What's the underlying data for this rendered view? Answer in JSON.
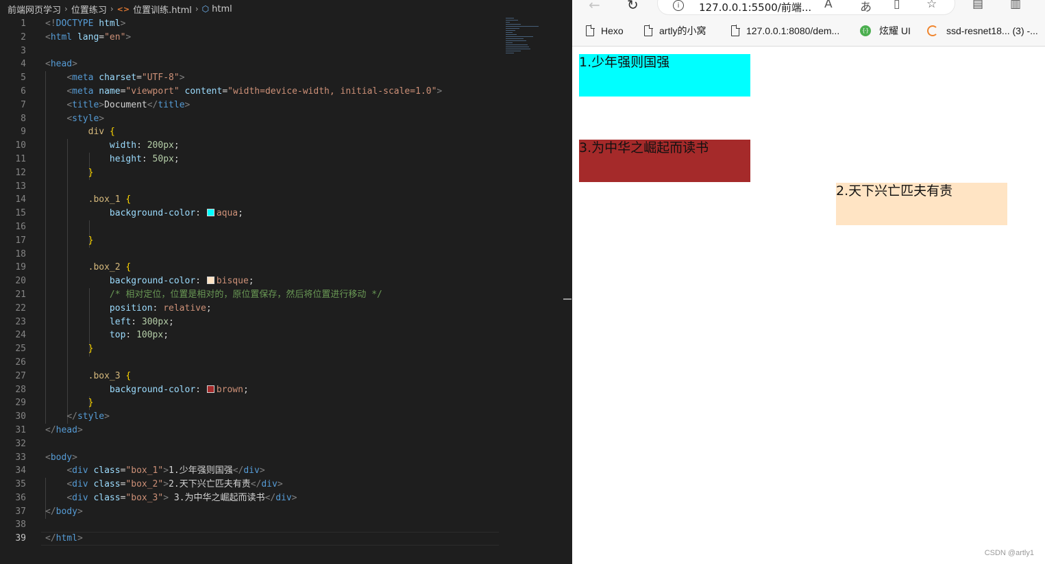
{
  "editor": {
    "breadcrumb": [
      "前端网页学习",
      "位置练习",
      "位置训练.html",
      "html"
    ],
    "current_line": 39
  },
  "browser": {
    "url": "127.0.0.1:5500/前端...",
    "favorites": [
      "Hexo",
      "artly的小窝",
      "127.0.0.1:8080/dem...",
      "炫耀 UI",
      "ssd-resnet18... (3) -..."
    ],
    "boxes": {
      "box_1": "1.少年强则国强",
      "box_2": "2.天下兴亡匹夫有责",
      "box_3": "3.为中华之崛起而读书"
    },
    "watermark": "CSDN @artly1"
  },
  "colors": {
    "aqua": "#00ffff",
    "bisque": "#ffe4c4",
    "brown": "#a52a2a"
  },
  "code_lines": [
    [
      [
        "t-bk",
        "<!"
      ],
      [
        "t-tag",
        "DOCTYPE"
      ],
      [
        "t-text",
        " "
      ],
      [
        "t-attr",
        "html"
      ],
      [
        "t-bk",
        ">"
      ]
    ],
    [
      [
        "t-bk",
        "<"
      ],
      [
        "t-tag",
        "html"
      ],
      [
        "t-text",
        " "
      ],
      [
        "t-attr",
        "lang"
      ],
      [
        "t-text",
        "="
      ],
      [
        "t-str",
        "\"en\""
      ],
      [
        "t-bk",
        ">"
      ]
    ],
    [],
    [
      [
        "t-bk",
        "<"
      ],
      [
        "t-tag",
        "head"
      ],
      [
        "t-bk",
        ">"
      ]
    ],
    [
      [
        "t-text",
        "    "
      ],
      [
        "t-bk",
        "<"
      ],
      [
        "t-tag",
        "meta"
      ],
      [
        "t-text",
        " "
      ],
      [
        "t-attr",
        "charset"
      ],
      [
        "t-text",
        "="
      ],
      [
        "t-str",
        "\"UTF-8\""
      ],
      [
        "t-bk",
        ">"
      ]
    ],
    [
      [
        "t-text",
        "    "
      ],
      [
        "t-bk",
        "<"
      ],
      [
        "t-tag",
        "meta"
      ],
      [
        "t-text",
        " "
      ],
      [
        "t-attr",
        "name"
      ],
      [
        "t-text",
        "="
      ],
      [
        "t-str",
        "\"viewport\""
      ],
      [
        "t-text",
        " "
      ],
      [
        "t-attr",
        "content"
      ],
      [
        "t-text",
        "="
      ],
      [
        "t-str",
        "\"width=device-width, initial-scale=1.0\""
      ],
      [
        "t-bk",
        ">"
      ]
    ],
    [
      [
        "t-text",
        "    "
      ],
      [
        "t-bk",
        "<"
      ],
      [
        "t-tag",
        "title"
      ],
      [
        "t-bk",
        ">"
      ],
      [
        "t-text",
        "Document"
      ],
      [
        "t-bk",
        "</"
      ],
      [
        "t-tag",
        "title"
      ],
      [
        "t-bk",
        ">"
      ]
    ],
    [
      [
        "t-text",
        "    "
      ],
      [
        "t-bk",
        "<"
      ],
      [
        "t-tag",
        "style"
      ],
      [
        "t-bk",
        ">"
      ]
    ],
    [
      [
        "t-text",
        "        "
      ],
      [
        "t-el",
        "div"
      ],
      [
        "t-text",
        " "
      ],
      [
        "t-brace",
        "{"
      ]
    ],
    [
      [
        "t-text",
        "            "
      ],
      [
        "t-prop",
        "width"
      ],
      [
        "t-text",
        ": "
      ],
      [
        "t-num",
        "200px"
      ],
      [
        "t-text",
        ";"
      ]
    ],
    [
      [
        "t-text",
        "            "
      ],
      [
        "t-prop",
        "height"
      ],
      [
        "t-text",
        ": "
      ],
      [
        "t-num",
        "50px"
      ],
      [
        "t-text",
        ";"
      ]
    ],
    [
      [
        "t-text",
        "        "
      ],
      [
        "t-brace",
        "}"
      ]
    ],
    [],
    [
      [
        "t-text",
        "        "
      ],
      [
        "t-sel",
        ".box_1"
      ],
      [
        "t-text",
        " "
      ],
      [
        "t-brace",
        "{"
      ]
    ],
    [
      [
        "t-text",
        "            "
      ],
      [
        "t-prop",
        "background-color"
      ],
      [
        "t-text",
        ": "
      ],
      [
        "swatch",
        "aqua"
      ],
      [
        "t-val",
        "aqua"
      ],
      [
        "t-text",
        ";"
      ]
    ],
    [],
    [
      [
        "t-text",
        "        "
      ],
      [
        "t-brace",
        "}"
      ]
    ],
    [],
    [
      [
        "t-text",
        "        "
      ],
      [
        "t-sel",
        ".box_2"
      ],
      [
        "t-text",
        " "
      ],
      [
        "t-brace",
        "{"
      ]
    ],
    [
      [
        "t-text",
        "            "
      ],
      [
        "t-prop",
        "background-color"
      ],
      [
        "t-text",
        ": "
      ],
      [
        "swatch",
        "bisque"
      ],
      [
        "t-val",
        "bisque"
      ],
      [
        "t-text",
        ";"
      ]
    ],
    [
      [
        "t-text",
        "            "
      ],
      [
        "t-cmt",
        "/* 相对定位，位置是相对的，原位置保存，然后将位置进行移动 */"
      ]
    ],
    [
      [
        "t-text",
        "            "
      ],
      [
        "t-prop",
        "position"
      ],
      [
        "t-text",
        ": "
      ],
      [
        "t-val",
        "relative"
      ],
      [
        "t-text",
        ";"
      ]
    ],
    [
      [
        "t-text",
        "            "
      ],
      [
        "t-prop",
        "left"
      ],
      [
        "t-text",
        ": "
      ],
      [
        "t-num",
        "300px"
      ],
      [
        "t-text",
        ";"
      ]
    ],
    [
      [
        "t-text",
        "            "
      ],
      [
        "t-prop",
        "top"
      ],
      [
        "t-text",
        ": "
      ],
      [
        "t-num",
        "100px"
      ],
      [
        "t-text",
        ";"
      ]
    ],
    [
      [
        "t-text",
        "        "
      ],
      [
        "t-brace",
        "}"
      ]
    ],
    [],
    [
      [
        "t-text",
        "        "
      ],
      [
        "t-sel",
        ".box_3"
      ],
      [
        "t-text",
        " "
      ],
      [
        "t-brace",
        "{"
      ]
    ],
    [
      [
        "t-text",
        "            "
      ],
      [
        "t-prop",
        "background-color"
      ],
      [
        "t-text",
        ": "
      ],
      [
        "swatch",
        "brown"
      ],
      [
        "t-val",
        "brown"
      ],
      [
        "t-text",
        ";"
      ]
    ],
    [
      [
        "t-text",
        "        "
      ],
      [
        "t-brace",
        "}"
      ]
    ],
    [
      [
        "t-text",
        "    "
      ],
      [
        "t-bk",
        "</"
      ],
      [
        "t-tag",
        "style"
      ],
      [
        "t-bk",
        ">"
      ]
    ],
    [
      [
        "t-bk",
        "</"
      ],
      [
        "t-tag",
        "head"
      ],
      [
        "t-bk",
        ">"
      ]
    ],
    [],
    [
      [
        "t-bk",
        "<"
      ],
      [
        "t-tag",
        "body"
      ],
      [
        "t-bk",
        ">"
      ]
    ],
    [
      [
        "t-text",
        "    "
      ],
      [
        "t-bk",
        "<"
      ],
      [
        "t-tag",
        "div"
      ],
      [
        "t-text",
        " "
      ],
      [
        "t-attr",
        "class"
      ],
      [
        "t-text",
        "="
      ],
      [
        "t-str",
        "\"box_1\""
      ],
      [
        "t-bk",
        ">"
      ],
      [
        "t-text",
        "1.少年强则国强"
      ],
      [
        "t-bk",
        "</"
      ],
      [
        "t-tag",
        "div"
      ],
      [
        "t-bk",
        ">"
      ]
    ],
    [
      [
        "t-text",
        "    "
      ],
      [
        "t-bk",
        "<"
      ],
      [
        "t-tag",
        "div"
      ],
      [
        "t-text",
        " "
      ],
      [
        "t-attr",
        "class"
      ],
      [
        "t-text",
        "="
      ],
      [
        "t-str",
        "\"box_2\""
      ],
      [
        "t-bk",
        ">"
      ],
      [
        "t-text",
        "2.天下兴亡匹夫有责"
      ],
      [
        "t-bk",
        "</"
      ],
      [
        "t-tag",
        "div"
      ],
      [
        "t-bk",
        ">"
      ]
    ],
    [
      [
        "t-text",
        "    "
      ],
      [
        "t-bk",
        "<"
      ],
      [
        "t-tag",
        "div"
      ],
      [
        "t-text",
        " "
      ],
      [
        "t-attr",
        "class"
      ],
      [
        "t-text",
        "="
      ],
      [
        "t-str",
        "\"box_3\""
      ],
      [
        "t-bk",
        ">"
      ],
      [
        "t-text",
        " 3.为中华之崛起而读书"
      ],
      [
        "t-bk",
        "</"
      ],
      [
        "t-tag",
        "div"
      ],
      [
        "t-bk",
        ">"
      ]
    ],
    [
      [
        "t-bk",
        "</"
      ],
      [
        "t-tag",
        "body"
      ],
      [
        "t-bk",
        ">"
      ]
    ],
    [],
    [
      [
        "t-bk",
        "</"
      ],
      [
        "t-tag",
        "html"
      ],
      [
        "t-bk",
        ">"
      ]
    ]
  ]
}
